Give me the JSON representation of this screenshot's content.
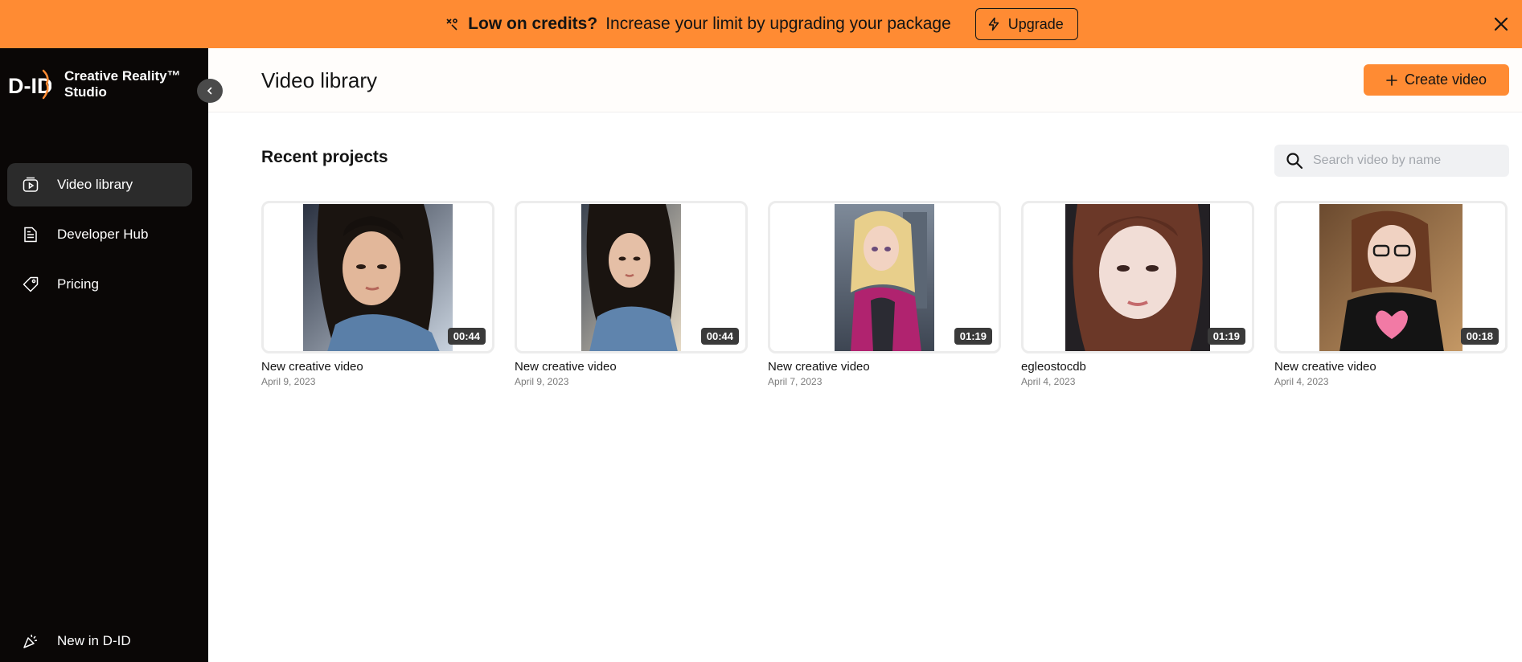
{
  "banner": {
    "strong": "Low on credits?",
    "text": "Increase your limit by upgrading your package",
    "upgrade_label": "Upgrade",
    "background": "#ff8b33"
  },
  "sidebar": {
    "brand_logo_text": "D-ID",
    "brand_name_line1": "Creative Reality™",
    "brand_name_line2": "Studio",
    "items": [
      {
        "label": "Video library",
        "icon": "video-library-icon",
        "active": true
      },
      {
        "label": "Developer Hub",
        "icon": "document-icon",
        "active": false
      },
      {
        "label": "Pricing",
        "icon": "price-tag-icon",
        "active": false
      }
    ],
    "bottom_label": "New in D-ID",
    "bottom_icon": "party-popper-icon"
  },
  "header": {
    "title": "Video library",
    "create_label": "Create video"
  },
  "recent": {
    "title": "Recent projects",
    "search_placeholder": "Search video by name",
    "cards": [
      {
        "title": "New creative video",
        "date": "April 9, 2023",
        "duration": "00:44"
      },
      {
        "title": "New creative video",
        "date": "April 9, 2023",
        "duration": "00:44"
      },
      {
        "title": "New creative video",
        "date": "April 7, 2023",
        "duration": "01:19"
      },
      {
        "title": "egleostocdb",
        "date": "April 4, 2023",
        "duration": "01:19"
      },
      {
        "title": "New creative video",
        "date": "April 4, 2023",
        "duration": "00:18"
      }
    ]
  },
  "colors": {
    "accent": "#ff8b33",
    "sidebar_bg": "#0a0706",
    "active_item_bg": "#2b2b2b"
  }
}
